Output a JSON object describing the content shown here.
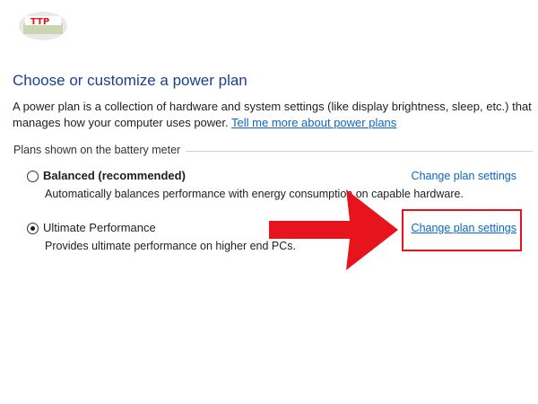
{
  "page": {
    "title": "Choose or customize a power plan",
    "description": "A power plan is a collection of hardware and system settings (like display brightness, sleep, etc.) that manages how your computer uses power.",
    "learn_more_link": "Tell me more about power plans"
  },
  "group": {
    "label": "Plans shown on the battery meter"
  },
  "plans": [
    {
      "name": "Balanced (recommended)",
      "description": "Automatically balances performance with energy consumption on capable hardware.",
      "link": "Change plan settings",
      "selected": false
    },
    {
      "name": "Ultimate Performance",
      "description": "Provides ultimate performance on higher end PCs.",
      "link": "Change plan settings",
      "selected": true
    }
  ],
  "colors": {
    "title": "#1c3f8f",
    "link": "#0b66c3",
    "annotation": "#e8141d"
  },
  "logo": {
    "text": "TTP",
    "icon": "logo-badge-icon"
  },
  "annotation": {
    "icon": "red-arrow-icon"
  }
}
